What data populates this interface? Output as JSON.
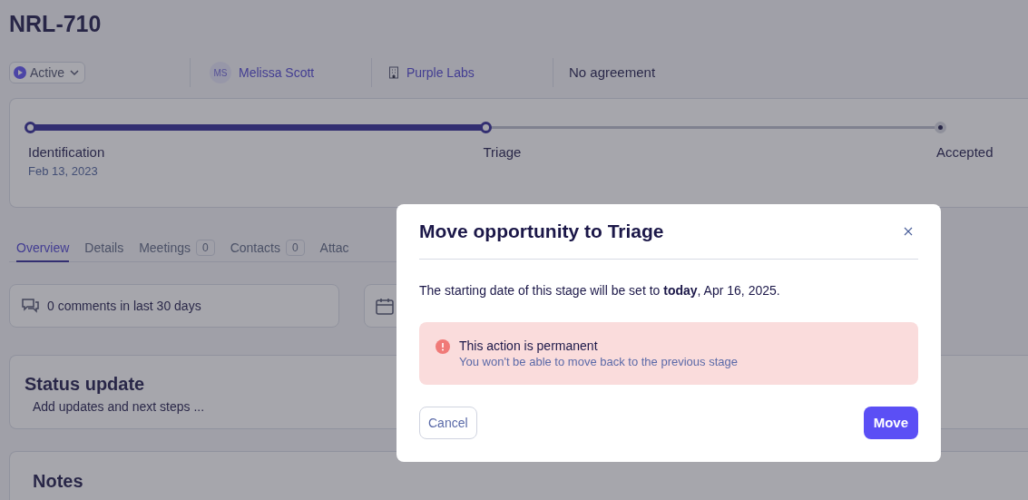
{
  "title": "NRL-710",
  "meta": {
    "status": "Active",
    "owner_initials": "MS",
    "owner": "Melissa Scott",
    "company": "Purple Labs",
    "agreement": "No agreement"
  },
  "progress": {
    "level": 0.5,
    "stages": [
      {
        "label": "Identification",
        "date": "Feb 13, 2023",
        "reached": true
      },
      {
        "label": "Triage",
        "reached": true
      },
      {
        "label": "Accepted",
        "reached": false
      }
    ]
  },
  "tabs": [
    {
      "label": "Overview",
      "selected": true
    },
    {
      "label": "Details",
      "selected": false
    },
    {
      "label": "Meetings",
      "count": "0",
      "selected": false
    },
    {
      "label": "Contacts",
      "count": "0",
      "selected": false
    },
    {
      "label": "Attac",
      "selected": false
    }
  ],
  "comments": "0 comments in last 30 days",
  "status_update": {
    "title": "Status update",
    "placeholder": "Add updates and next steps ..."
  },
  "notes": {
    "title": "Notes"
  },
  "dialog": {
    "title": "Move opportunity to Triage",
    "message": "The starting date of this stage will be set to **today**, Apr 16, 2025.",
    "warning_title": "This action is permanent",
    "warning_text": "You won't be able to move back to the previous stage",
    "buttons": [
      {
        "label": "Cancel",
        "kind": "secondary"
      },
      {
        "label": "Move",
        "kind": "primary"
      }
    ]
  }
}
